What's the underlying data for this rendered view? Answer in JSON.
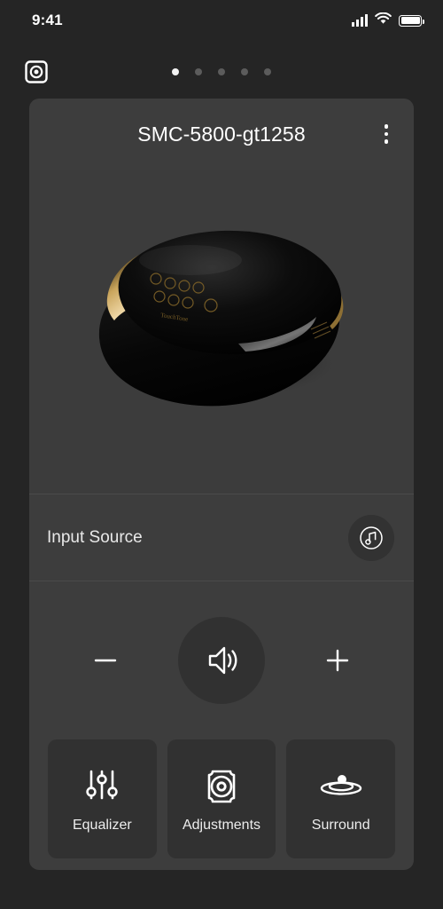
{
  "status_bar": {
    "time": "9:41",
    "signal_icon": "cellular-signal-icon",
    "wifi_icon": "wifi-icon",
    "battery_icon": "battery-full-icon"
  },
  "nav": {
    "device_icon": "speaker-device-icon",
    "pager": {
      "total": 5,
      "active_index": 0
    }
  },
  "card": {
    "title": "SMC-5800-gt1258",
    "menu_icon": "more-vertical-icon",
    "product_image_alt": "black-and-gold-speaker"
  },
  "input_source": {
    "label": "Input Source",
    "button_icon": "music-note-icon"
  },
  "volume": {
    "decrease_icon": "minus-icon",
    "main_icon": "volume-speaker-icon",
    "increase_icon": "plus-icon"
  },
  "features": [
    {
      "label": "Equalizer",
      "icon": "equalizer-sliders-icon"
    },
    {
      "label": "Adjustments",
      "icon": "speaker-driver-icon"
    },
    {
      "label": "Surround",
      "icon": "surround-ripple-icon"
    }
  ],
  "colors": {
    "page_background": "#252525",
    "card_background": "#3d3d3d",
    "tile_background": "#313131",
    "accent_text": "#ffffff",
    "muted_dot": "#5c5c5c",
    "divider": "#4a4a4a"
  }
}
